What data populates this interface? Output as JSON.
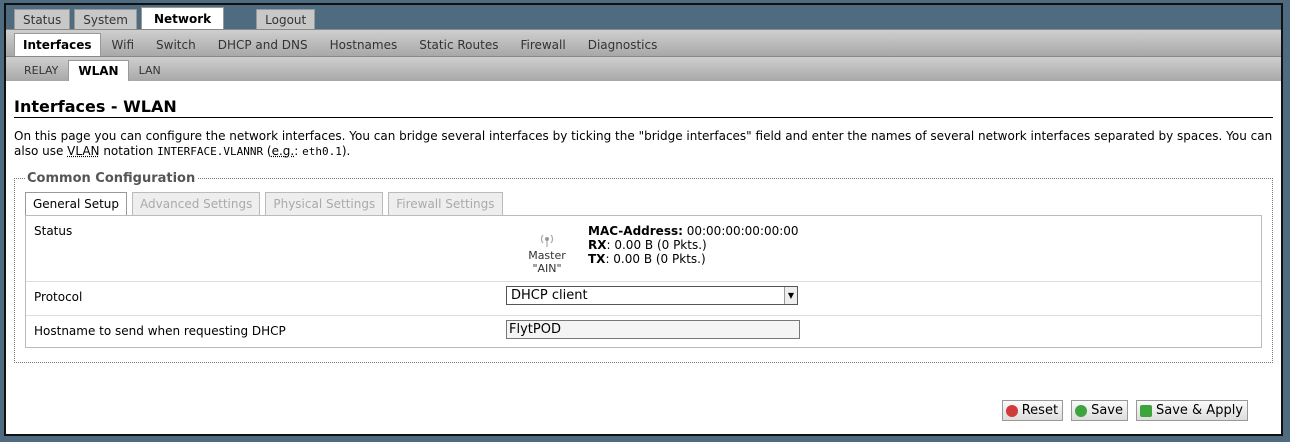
{
  "top_tabs": [
    "Status",
    "System",
    "Network",
    "Logout"
  ],
  "network_tabs": [
    "Interfaces",
    "Wifi",
    "Switch",
    "DHCP and DNS",
    "Hostnames",
    "Static Routes",
    "Firewall",
    "Diagnostics"
  ],
  "iface_tabs": [
    "RELAY",
    "WLAN",
    "LAN"
  ],
  "page": {
    "title": "Interfaces - WLAN",
    "desc_1": "On this page you can configure the network interfaces. You can bridge several interfaces by ticking the \"bridge interfaces\" field and enter the names of several network interfaces separated by spaces. You can also use ",
    "desc_vlan": "VLAN",
    "desc_2": " notation ",
    "desc_code": "INTERFACE.VLANNR",
    "desc_3": " (",
    "desc_eg": "e.g.",
    "desc_4": ": ",
    "desc_code2": "eth0.1",
    "desc_5": ")."
  },
  "fieldset": {
    "legend": "Common Configuration",
    "tabs": [
      "General Setup",
      "Advanced Settings",
      "Physical Settings",
      "Firewall Settings"
    ]
  },
  "status": {
    "label": "Status",
    "mode": "Master \"AIN\"",
    "mac_key": "MAC-Address:",
    "mac": "00:00:00:00:00:00",
    "rx_key": "RX",
    "rx": ": 0.00 B (0 Pkts.)",
    "tx_key": "TX",
    "tx": ": 0.00 B (0 Pkts.)"
  },
  "protocol": {
    "label": "Protocol",
    "value": "DHCP client"
  },
  "hostname": {
    "label": "Hostname to send when requesting DHCP",
    "value": "FlytPOD"
  },
  "buttons": {
    "reset": "Reset",
    "save": "Save",
    "save_apply": "Save & Apply"
  },
  "colors": {
    "header": "#4e6b80",
    "reset_icon": "#d03a3a",
    "save_icon": "#3ea43e"
  }
}
